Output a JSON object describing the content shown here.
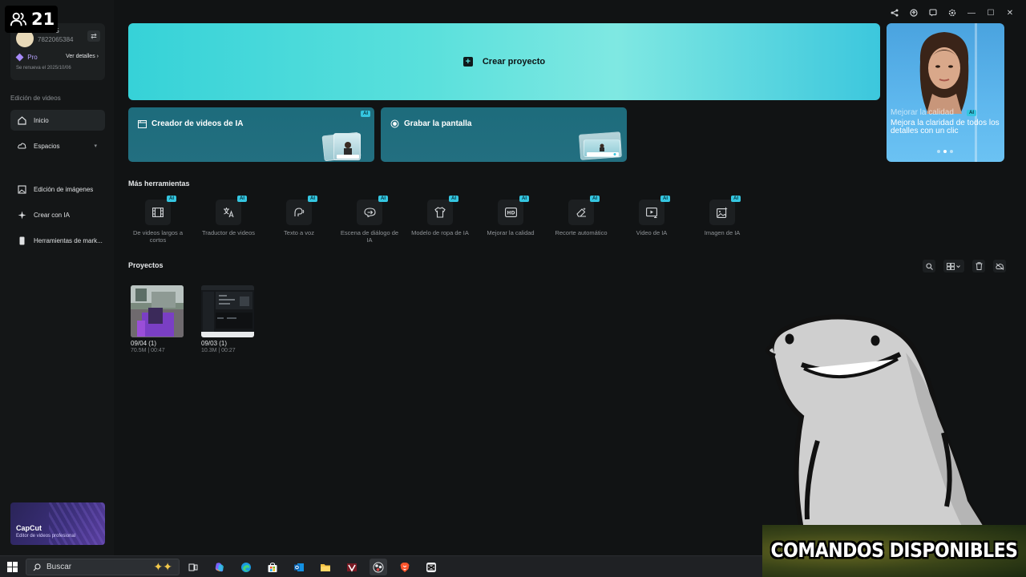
{
  "overlay": {
    "viewer_count": "21",
    "commands_banner": "COMANDOS DISPONIBLES"
  },
  "account": {
    "name": "384615",
    "id": "7822065384",
    "plan": "Pro",
    "details_link": "Ver detalles",
    "renewal": "Se renueva el 2025/10/06"
  },
  "sidebar": {
    "section_label": "Edición de videos",
    "items": [
      {
        "label": "Inicio"
      },
      {
        "label": "Espacios"
      },
      {
        "label": "Edición de imágenes"
      },
      {
        "label": "Crear con IA"
      },
      {
        "label": "Herramientas de mark..."
      }
    ],
    "promo_title": "CapCut",
    "promo_subtitle": "Editor de videos profesional"
  },
  "main": {
    "create_label": "Crear proyecto",
    "cards": [
      {
        "label": "Creador de videos de IA",
        "badge": "AI"
      },
      {
        "label": "Grabar la pantalla"
      }
    ],
    "side_promo": {
      "title": "Mejorar la calidad",
      "badge": "AI",
      "text": "Mejora la claridad de todos los detalles con un clic"
    },
    "more_tools_title": "Más herramientas",
    "tools": [
      {
        "label": "De videos largos a cortos",
        "badge": "AI",
        "icon": "film-icon"
      },
      {
        "label": "Traductor de videos",
        "badge": "AI",
        "icon": "translate-icon"
      },
      {
        "label": "Texto a voz",
        "badge": "AI",
        "icon": "voice-icon"
      },
      {
        "label": "Escena de diálogo de IA",
        "badge": "AI",
        "icon": "dialog-icon"
      },
      {
        "label": "Modelo de ropa de IA",
        "badge": "AI",
        "icon": "shirt-icon"
      },
      {
        "label": "Mejorar la calidad",
        "badge": "AI",
        "icon": "hd-icon"
      },
      {
        "label": "Recorte automático",
        "badge": "AI",
        "icon": "eraser-icon"
      },
      {
        "label": "Video de IA",
        "badge": "AI",
        "icon": "video-plus-icon"
      },
      {
        "label": "Imagen de IA",
        "badge": "AI",
        "icon": "image-sparkle-icon"
      }
    ],
    "projects_title": "Proyectos",
    "projects": [
      {
        "name": "09/04 (1)",
        "meta": "70.5M | 00:47"
      },
      {
        "name": "09/03 (1)",
        "meta": "10.3M | 00:27"
      }
    ]
  },
  "taskbar": {
    "search_placeholder": "Buscar"
  },
  "colors": {
    "accent_cyan": "#5ae0dc",
    "ai_badge": "#35c6e0",
    "background": "#111314"
  }
}
